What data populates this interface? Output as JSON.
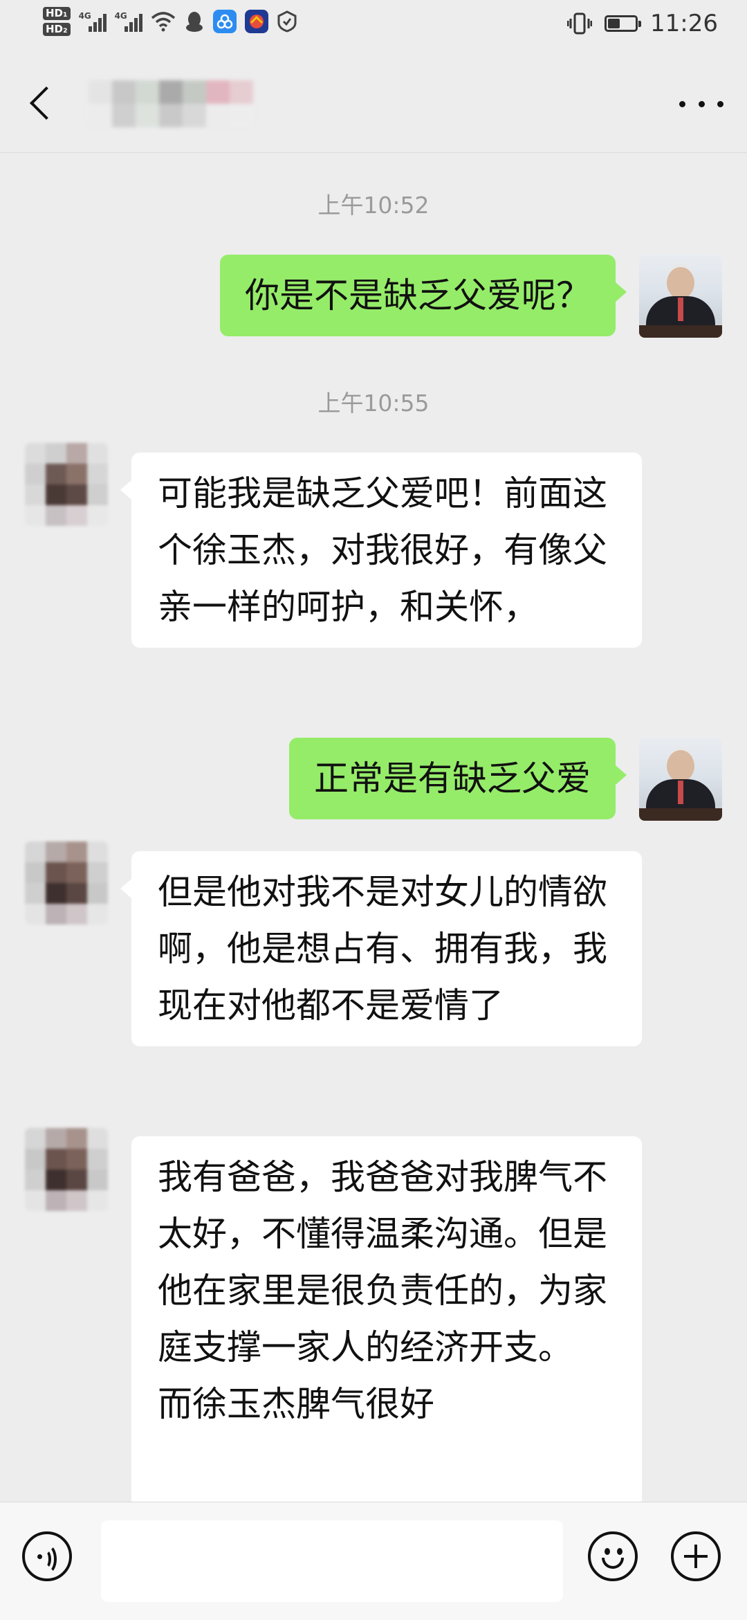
{
  "status_bar": {
    "hd1": "HD₁",
    "hd2": "HD₂",
    "net1": "4G",
    "net2": "4G",
    "time": "11:26",
    "icons": [
      "hd-icon",
      "signal-icon",
      "signal-icon",
      "wifi-icon",
      "qq-icon",
      "app-icon",
      "app-icon",
      "shield-icon",
      "vibrate-icon",
      "battery-icon"
    ],
    "battery_level": 0.45
  },
  "header": {
    "contact_name": "",
    "back_icon": "chevron-left-icon",
    "more_icon": "more-icon"
  },
  "messages": [
    {
      "type": "time",
      "text": "上午10:52"
    },
    {
      "type": "sent",
      "text": "你是不是缺乏父爱呢？"
    },
    {
      "type": "time",
      "text": "上午10:55"
    },
    {
      "type": "received",
      "text": "可能我是缺乏父爱吧！前面这个徐玉杰，对我很好，有像父亲一样的呵护，和关怀，"
    },
    {
      "type": "sent",
      "text": "正常是有缺乏父爱"
    },
    {
      "type": "received",
      "text": "但是他对我不是对女儿的情欲啊，他是想占有、拥有我，我现在对他都不是爱情了"
    },
    {
      "type": "received",
      "text": "我有爸爸，我爸爸对我脾气不太好，不懂得温柔沟通。但是他在家里是很负责任的，为家庭支撑一家人的经济开支。\n而徐玉杰脾气很好"
    }
  ],
  "input_bar": {
    "voice_icon": "voice-icon",
    "placeholder": "",
    "emoji_icon": "emoji-icon",
    "plus_icon": "plus-icon"
  }
}
